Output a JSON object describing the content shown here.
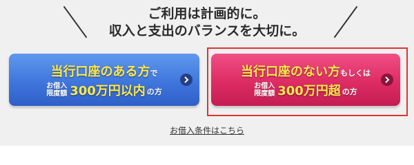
{
  "headline": {
    "line1": "ご利用は計画的に。",
    "line2": "収入と支出のバランスを大切に。"
  },
  "buttons": [
    {
      "line1_emphasis": "当行口座のある方",
      "line1_suffix": "で",
      "limit_line1": "お借入",
      "limit_line2": "限度額",
      "amount": "300万円以内",
      "amount_suffix": "の方",
      "color": "#3f76dc",
      "icon": "chevron-right-icon"
    },
    {
      "line1_emphasis": "当行口座のない方",
      "line1_suffix": "もしくは",
      "limit_line1": "お借入",
      "limit_line2": "限度額",
      "amount": "300万円超",
      "amount_suffix": "の方",
      "color": "#dd2c63",
      "highlight_border_color": "#e0322f",
      "icon": "chevron-right-icon"
    }
  ],
  "conditions_link": "お借入条件はこちら",
  "colors": {
    "emphasis_text": "#ffe94a",
    "panel_background": "#f0f0f0"
  }
}
